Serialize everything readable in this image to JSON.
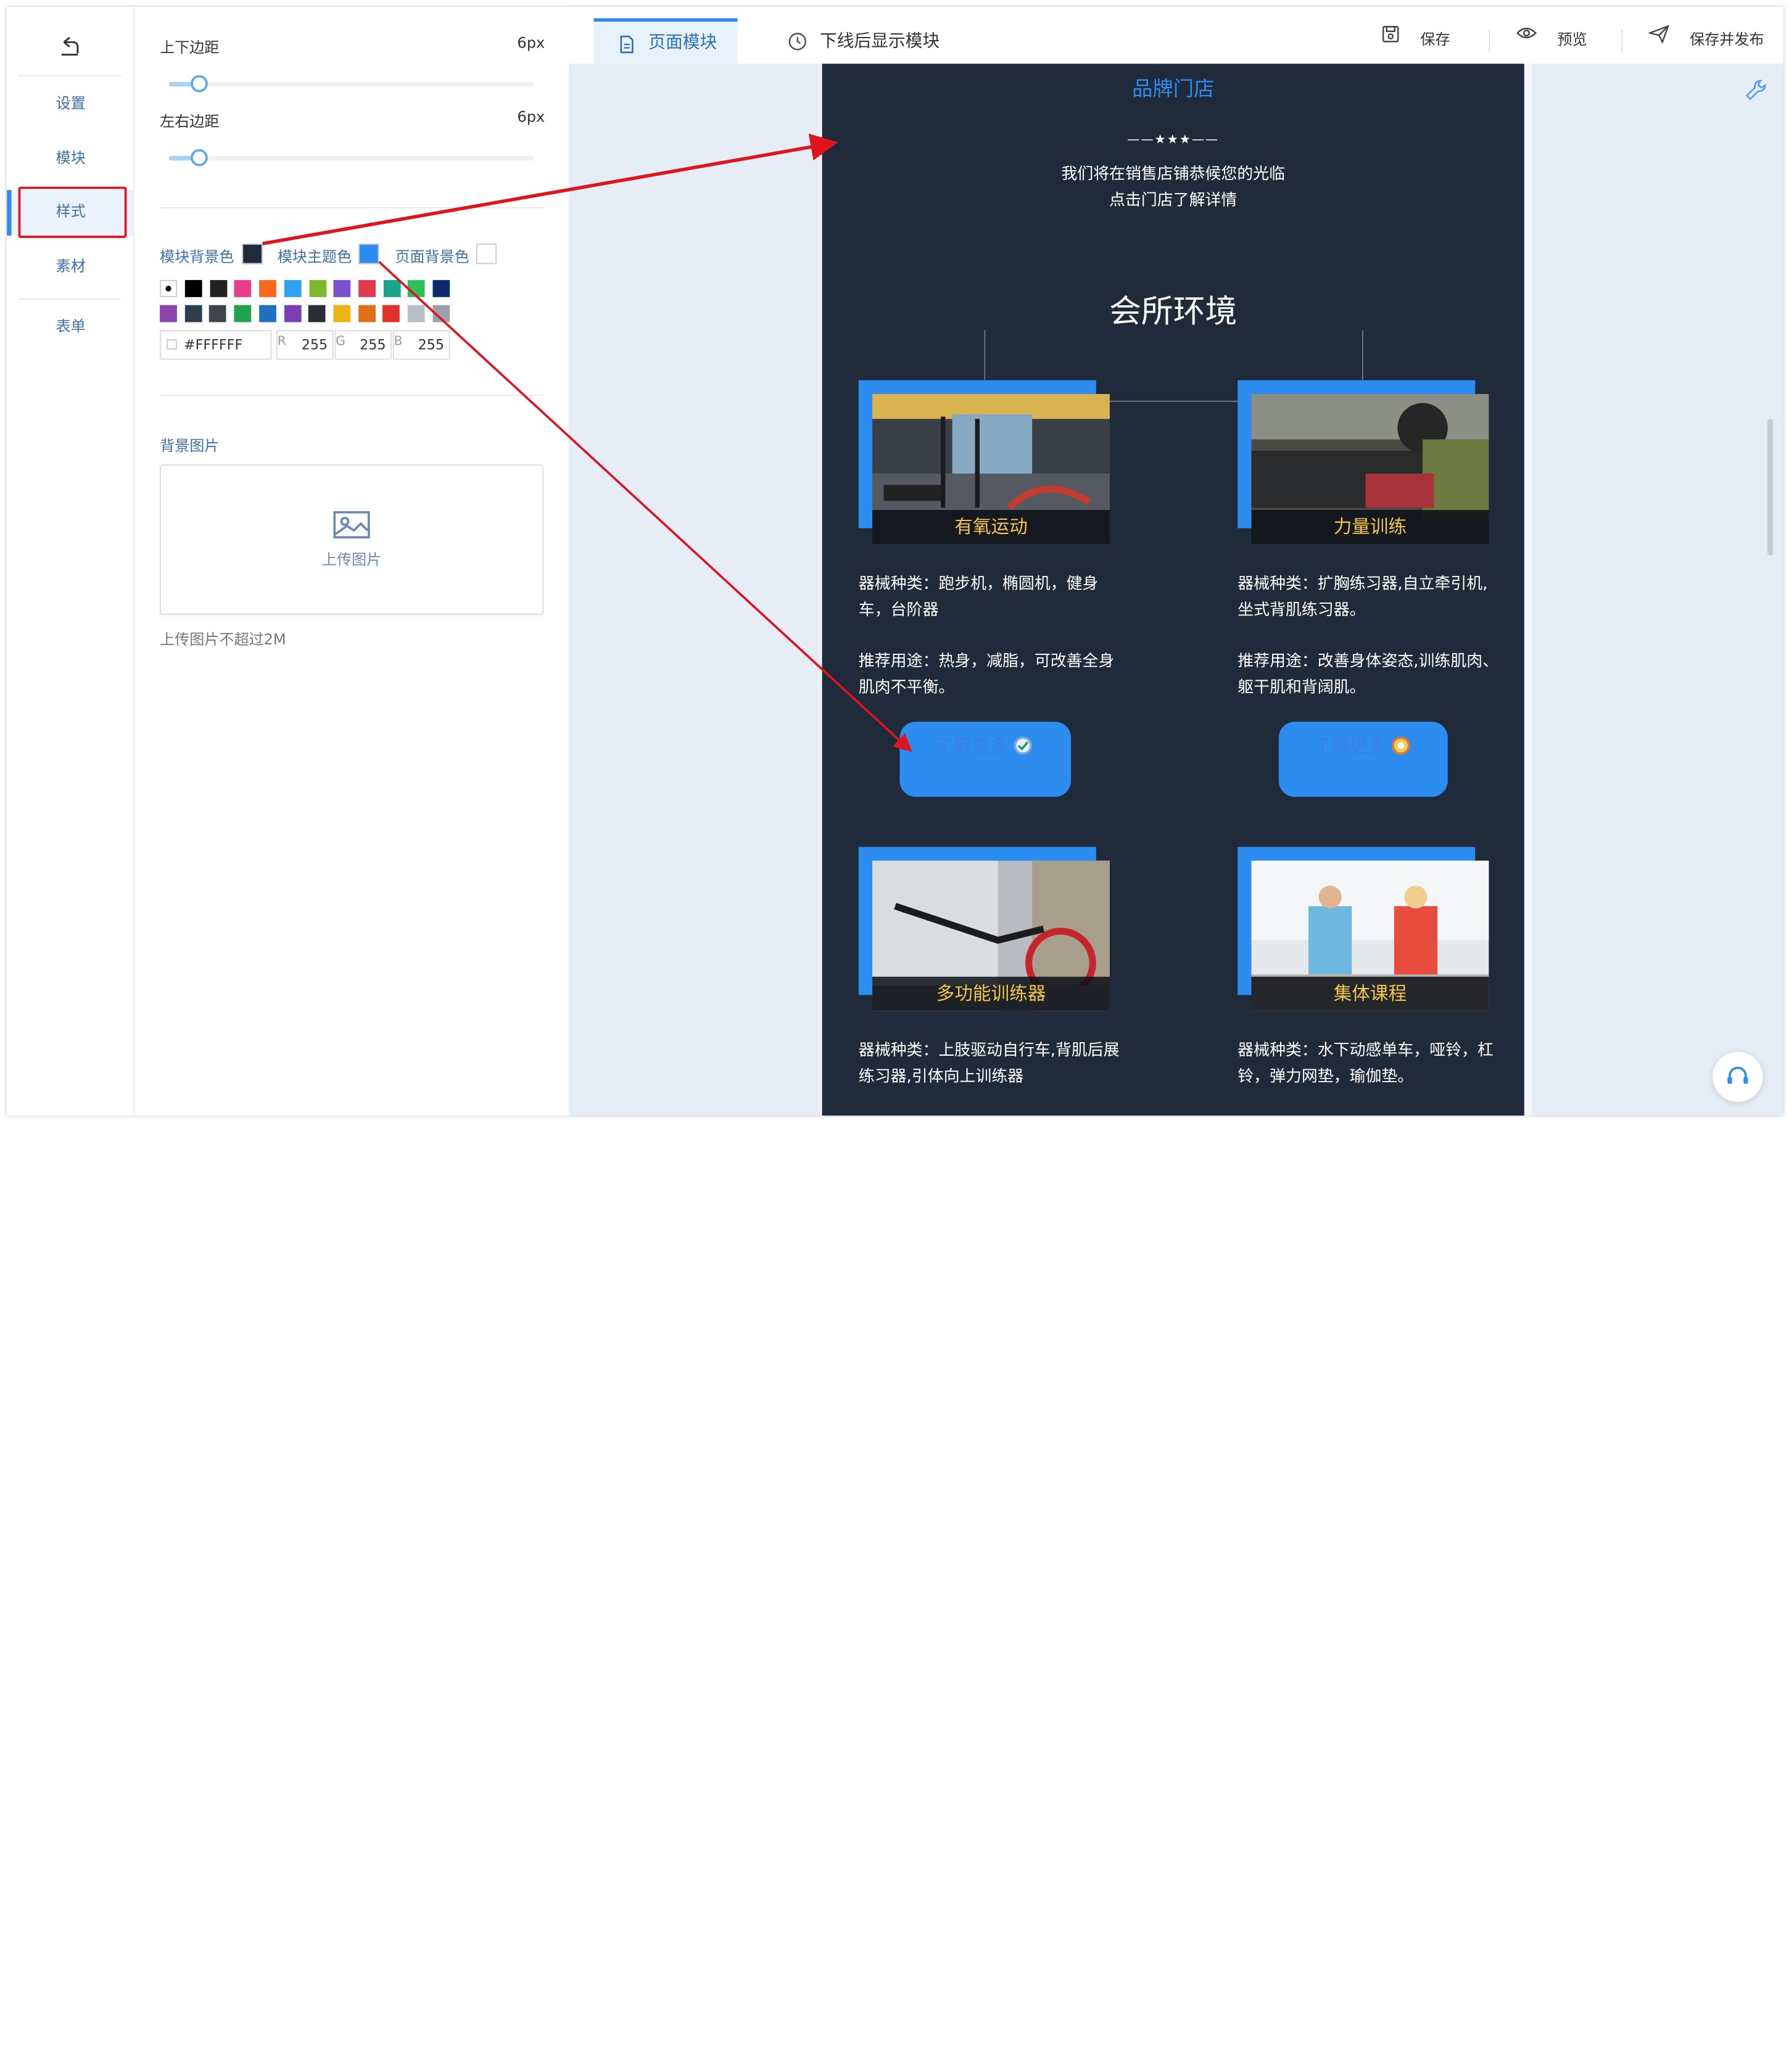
{
  "nav": {
    "items": [
      {
        "label": "设置"
      },
      {
        "label": "模块"
      },
      {
        "label": "样式"
      },
      {
        "label": "素材"
      },
      {
        "label": "表单"
      }
    ],
    "active": "样式"
  },
  "style_panel": {
    "vertical_padding": {
      "label": "上下边距",
      "value": "6px",
      "level_percent": 8
    },
    "horizontal_padding": {
      "label": "左右边距",
      "value": "6px",
      "level_percent": 8
    },
    "colors": {
      "module_bg": {
        "label": "模块背景色",
        "color": "#1f2a3a"
      },
      "module_theme": {
        "label": "模块主题色",
        "color": "#2d8cf0"
      },
      "page_bg": {
        "label": "页面背景色",
        "color": "#ffffff"
      }
    },
    "palette_row1": [
      "#000000",
      "#222222",
      "#e83e8c",
      "#fa6a1c",
      "#2fa3ef",
      "#7cb82f",
      "#7b4fcf",
      "#e03a4b",
      "#1aa589",
      "#2ebf5b",
      "#0a2b6e"
    ],
    "palette_row2": [
      "#8e44ad",
      "#2c3e50",
      "#3d4650",
      "#20a34a",
      "#1f6fc2",
      "#7a3fb3",
      "#2b2f35",
      "#f0b114",
      "#e0701a",
      "#e0322b",
      "#b8bfc6",
      "#9aa3ad"
    ],
    "hex": "#FFFFFF",
    "r_tag": "R",
    "r": "255",
    "g_tag": "G",
    "g": "255",
    "b_tag": "B",
    "b": "255",
    "bg_image_label": "背景图片",
    "upload_label": "上传图片",
    "upload_hint": "上传图片不超过2M"
  },
  "topbar": {
    "tab_page_modules": "页面模块",
    "tab_offline_modules": "下线后显示模块",
    "save": "保存",
    "preview": "预览",
    "save_publish": "保存并发布"
  },
  "preview": {
    "brand_title": "品牌门店",
    "stars": "——★★★——",
    "welcome_line1": "我们将在销售店铺恭候您的光临",
    "welcome_line2": "点击门店了解详情",
    "section_title": "会所环境",
    "cards": [
      {
        "title": "有氧运动",
        "desc1": "器械种类：跑步机，椭圆机，健身车，台阶器",
        "desc2": "推荐用途：热身，减脂，可改善全身肌肉不平衡。",
        "button": "了解更多"
      },
      {
        "title": "力量训练",
        "desc1": "器械种类：扩胸练习器,自立牵引机,坐式背肌练习器。",
        "desc2": "推荐用途：改善身体姿态,训练肌肉、躯干肌和背阔肌。",
        "button": "了解更多"
      },
      {
        "title": "多功能训练器",
        "desc1": "器械种类：上肢驱动自行车,背肌后展练习器,引体向上训练器",
        "desc2": "",
        "button": ""
      },
      {
        "title": "集体课程",
        "desc1": "器械种类：水下动感单车，哑铃，杠铃，弹力网垫，瑜伽垫。",
        "desc2": "",
        "button": ""
      }
    ]
  },
  "annotation": {
    "color": "#e0141e"
  }
}
